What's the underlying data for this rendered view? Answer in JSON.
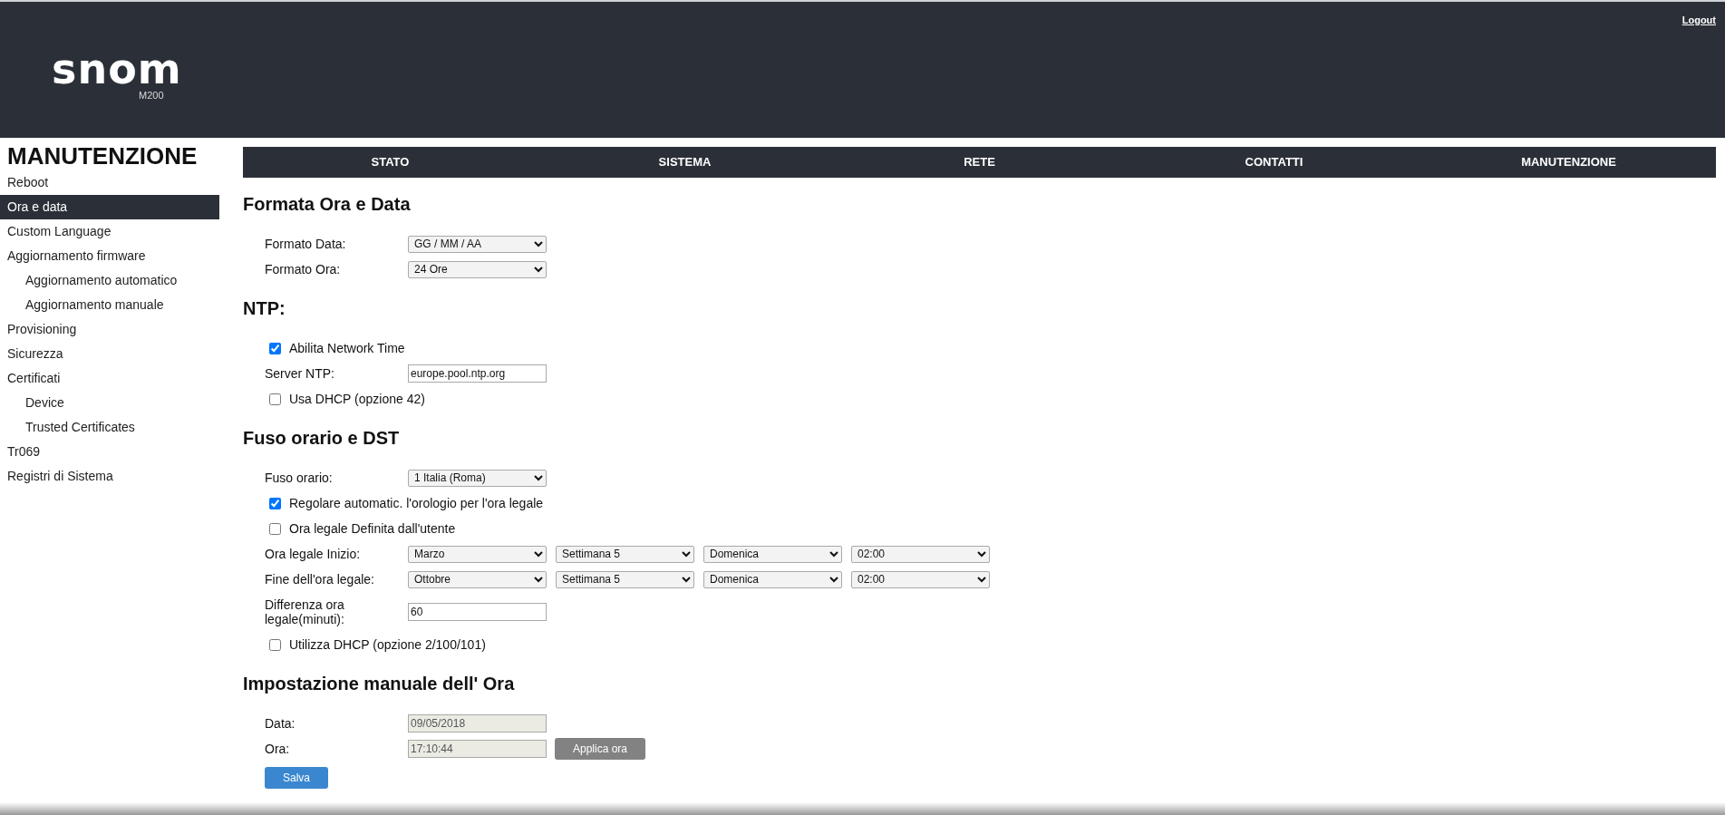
{
  "header": {
    "logo": "snom",
    "model": "M200",
    "logout": "Logout"
  },
  "sidebar": {
    "title": "MANUTENZIONE",
    "items": [
      {
        "label": "Reboot",
        "selected": false
      },
      {
        "label": "Ora e data",
        "selected": true
      },
      {
        "label": "Custom Language",
        "selected": false
      },
      {
        "label": "Aggiornamento firmware",
        "selected": false,
        "children": [
          {
            "label": "Aggiornamento automatico",
            "selected": false
          },
          {
            "label": "Aggiornamento manuale",
            "selected": false
          }
        ]
      },
      {
        "label": "Provisioning",
        "selected": false
      },
      {
        "label": "Sicurezza",
        "selected": false
      },
      {
        "label": "Certificati",
        "selected": false,
        "children": [
          {
            "label": "Device",
            "selected": false
          },
          {
            "label": "Trusted Certificates",
            "selected": false
          }
        ]
      },
      {
        "label": "Tr069",
        "selected": false
      },
      {
        "label": "Registri di Sistema",
        "selected": false
      }
    ]
  },
  "nav": {
    "tabs": [
      {
        "label": "STATO"
      },
      {
        "label": "SISTEMA"
      },
      {
        "label": "RETE"
      },
      {
        "label": "CONTATTI"
      },
      {
        "label": "MANUTENZIONE"
      }
    ]
  },
  "sections": [
    {
      "title": "Formata Ora e Data",
      "rows": [
        {
          "kind": "select",
          "label": "Formato Data:",
          "values": [
            "GG / MM / AA"
          ]
        },
        {
          "kind": "select",
          "label": "Formato Ora:",
          "values": [
            "24 Ore"
          ]
        }
      ]
    },
    {
      "title": "NTP:",
      "rows": [
        {
          "kind": "checkbox",
          "label": "Abilita Network Time",
          "checked": true
        },
        {
          "kind": "text",
          "label": "Server NTP:",
          "value": "europe.pool.ntp.org",
          "disabled": false
        },
        {
          "kind": "checkbox",
          "label": "Usa DHCP (opzione 42)",
          "checked": false
        }
      ]
    },
    {
      "title": "Fuso orario e DST",
      "rows": [
        {
          "kind": "select",
          "label": "Fuso orario:",
          "values": [
            "1 Italia (Roma)"
          ]
        },
        {
          "kind": "checkbox",
          "label": "Regolare automatic. l'orologio per l'ora legale",
          "checked": true
        },
        {
          "kind": "checkbox",
          "label": "Ora legale Definita dall'utente",
          "checked": false
        },
        {
          "kind": "select",
          "label": "Ora legale Inizio:",
          "values": [
            "Marzo",
            "Settimana 5",
            "Domenica",
            "02:00"
          ]
        },
        {
          "kind": "select",
          "label": "Fine dell'ora legale:",
          "values": [
            "Ottobre",
            "Settimana 5",
            "Domenica",
            "02:00"
          ]
        },
        {
          "kind": "text",
          "label": "Differenza ora legale(minuti):",
          "value": "60",
          "disabled": false
        },
        {
          "kind": "checkbox",
          "label": "Utilizza DHCP (opzione 2/100/101)",
          "checked": false
        }
      ]
    },
    {
      "title": "Impostazione manuale dell' Ora",
      "rows": [
        {
          "kind": "text",
          "label": "Data:",
          "value": "09/05/2018",
          "disabled": true
        },
        {
          "kind": "text",
          "label": "Ora:",
          "value": "17:10:44",
          "disabled": true,
          "button": "Applica ora"
        }
      ]
    }
  ],
  "save_button": "Salva"
}
